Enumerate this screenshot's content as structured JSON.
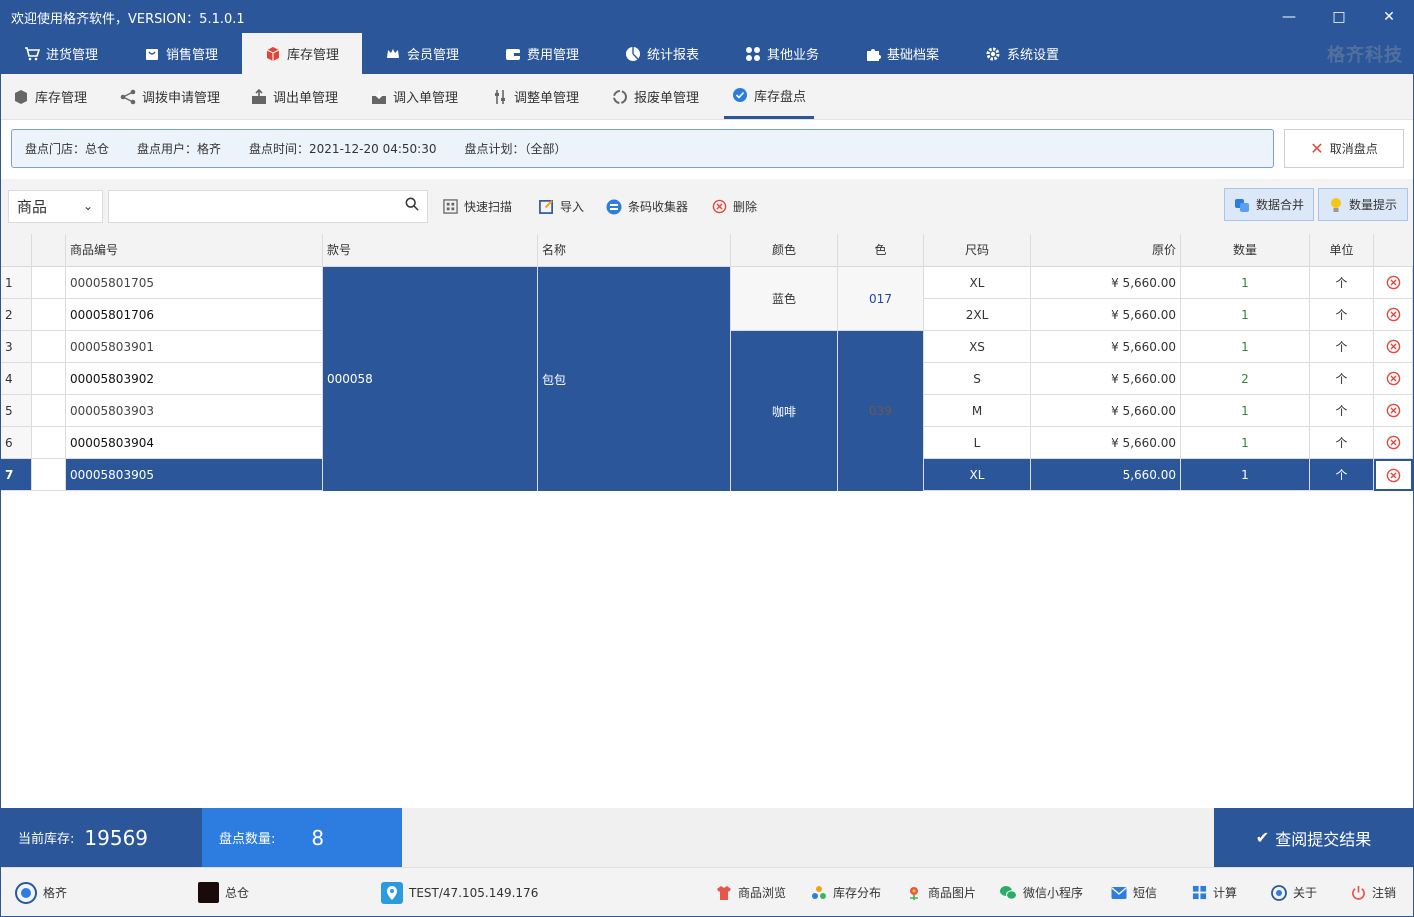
{
  "window": {
    "title": "欢迎使用格齐软件，VERSION：5.1.0.1",
    "minimize": "—",
    "maximize": "□",
    "close": "✕"
  },
  "main_menu": {
    "items": [
      "进货管理",
      "销售管理",
      "库存管理",
      "会员管理",
      "费用管理",
      "统计报表",
      "其他业务",
      "基础档案",
      "系统设置"
    ],
    "active": "库存管理",
    "brand": "格齐科技"
  },
  "sub_menu": {
    "items": [
      "库存管理",
      "调拨申请管理",
      "调出单管理",
      "调入单管理",
      "调整单管理",
      "报废单管理",
      "库存盘点"
    ],
    "active": "库存盘点"
  },
  "info": {
    "store": "盘点门店：总仓",
    "user": "盘点用户：格齐",
    "time": "盘点时间：2021-12-20 04:50:30",
    "plan": "盘点计划：（全部）",
    "cancel_label": "取消盘点"
  },
  "toolbar": {
    "select_value": "商品",
    "search_value": "",
    "quick_scan": "快速扫描",
    "import": "导入",
    "barcode_collector": "条码收集器",
    "delete": "删除",
    "merge_data": "数据合并",
    "qty_hint": "数量提示"
  },
  "table": {
    "headers": [
      "商品编号",
      "款号",
      "名称",
      "颜色",
      "色",
      "尺码",
      "原价",
      "数量",
      "单位"
    ],
    "style_no": "000058",
    "name": "包包",
    "color_groups": [
      {
        "color": "蓝色",
        "code": "017"
      },
      {
        "color": "咖啡",
        "code": "039"
      }
    ],
    "rows": [
      {
        "idx": "1",
        "code": "00005801705",
        "size": "XL",
        "price": "¥ 5,660.00",
        "qty": "1",
        "unit": "个"
      },
      {
        "idx": "2",
        "code": "00005801706",
        "size": "2XL",
        "price": "¥ 5,660.00",
        "qty": "1",
        "unit": "个"
      },
      {
        "idx": "3",
        "code": "00005803901",
        "size": "XS",
        "price": "¥ 5,660.00",
        "qty": "1",
        "unit": "个"
      },
      {
        "idx": "4",
        "code": "00005803902",
        "size": "S",
        "price": "¥ 5,660.00",
        "qty": "2",
        "unit": "个"
      },
      {
        "idx": "5",
        "code": "00005803903",
        "size": "M",
        "price": "¥ 5,660.00",
        "qty": "1",
        "unit": "个"
      },
      {
        "idx": "6",
        "code": "00005803904",
        "size": "L",
        "price": "¥ 5,660.00",
        "qty": "1",
        "unit": "个"
      },
      {
        "idx": "7",
        "code": "00005803905",
        "size": "XL",
        "price": "5,660.00",
        "qty": "1",
        "unit": "个"
      }
    ]
  },
  "status": {
    "stock_label": "当前库存:",
    "stock_value": "19569",
    "count_label": "盘点数量:",
    "count_value": "8",
    "submit_label": "查阅提交结果"
  },
  "footer": {
    "user": "格齐",
    "store": "总仓",
    "server": "TEST/47.105.149.176",
    "links": [
      "商品浏览",
      "库存分布",
      "商品图片",
      "微信小程序",
      "短信",
      "计算",
      "关于",
      "注销"
    ]
  },
  "colors": {
    "primary": "#2b579a",
    "accent_blue": "#2d7de0",
    "danger": "#e24a3b",
    "qty_green": "#2e8b2e"
  }
}
